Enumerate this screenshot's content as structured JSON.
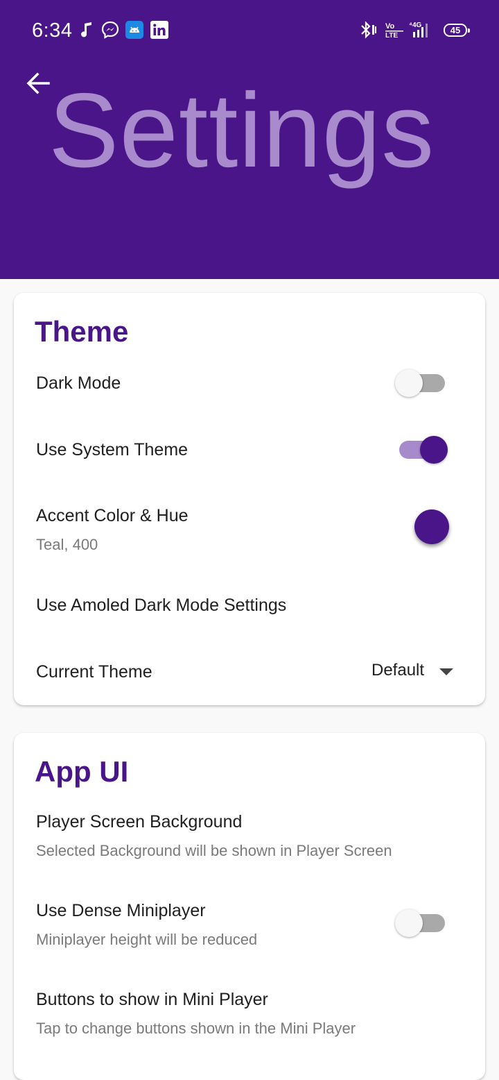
{
  "status_bar": {
    "time": "6:34",
    "notification_icons": [
      "music-note-icon",
      "messenger-icon",
      "android-app-icon",
      "linkedin-icon"
    ],
    "right_icons": [
      "bluetooth-icon",
      "volte-icon",
      "signal-4g-icon"
    ],
    "battery_level": "45"
  },
  "header": {
    "title": "Settings",
    "back_icon": "arrow-back-icon",
    "background_color": "#4a1589",
    "title_color": "#a98acd"
  },
  "theme_card": {
    "title": "Theme",
    "dark_mode": {
      "label": "Dark Mode",
      "enabled": false
    },
    "use_system_theme": {
      "label": "Use System Theme",
      "enabled": true
    },
    "accent": {
      "label": "Accent Color & Hue",
      "value": "Teal, 400",
      "swatch_color": "#4a1589"
    },
    "amoled": {
      "label": "Use Amoled Dark Mode Settings"
    },
    "current_theme": {
      "label": "Current Theme",
      "value": "Default"
    }
  },
  "app_ui_card": {
    "title": "App UI",
    "player_background": {
      "label": "Player Screen Background",
      "subtitle": "Selected Background will be shown in Player Screen"
    },
    "dense_miniplayer": {
      "label": "Use Dense Miniplayer",
      "subtitle": "Miniplayer height will be reduced",
      "enabled": false
    },
    "mini_player_buttons": {
      "label": "Buttons to show in Mini Player",
      "subtitle": "Tap to change buttons shown in the Mini Player"
    }
  },
  "colors": {
    "accent": "#4a1589",
    "toggle_on_track": "#a78acb",
    "toggle_off_track": "#a9a9a9"
  }
}
